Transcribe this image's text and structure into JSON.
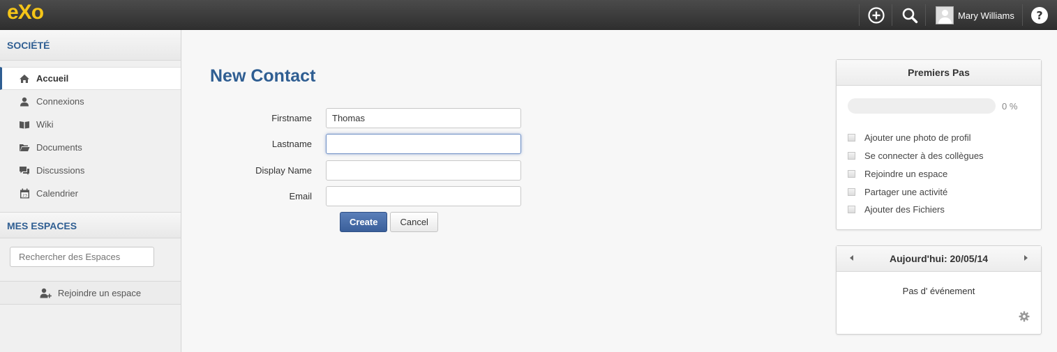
{
  "topbar": {
    "logo_text": "eXo",
    "user_name": "Mary Williams",
    "icons": [
      "add-icon",
      "search-icon",
      "help-icon"
    ]
  },
  "sidebar": {
    "company_title": "SOCIÉTÉ",
    "items": [
      {
        "label": "Accueil",
        "icon": "home-icon",
        "active": true
      },
      {
        "label": "Connexions",
        "icon": "user-icon",
        "active": false
      },
      {
        "label": "Wiki",
        "icon": "book-icon",
        "active": false
      },
      {
        "label": "Documents",
        "icon": "folder-icon",
        "active": false
      },
      {
        "label": "Discussions",
        "icon": "chat-icon",
        "active": false
      },
      {
        "label": "Calendrier",
        "icon": "calendar-icon",
        "active": false
      }
    ],
    "spaces_title": "MES ESPACES",
    "search_placeholder": "Rechercher des Espaces",
    "join_label": "Rejoindre un espace"
  },
  "main": {
    "title": "New Contact",
    "fields": [
      {
        "label": "Firstname",
        "value": "Thomas"
      },
      {
        "label": "Lastname",
        "value": ""
      },
      {
        "label": "Display Name",
        "value": ""
      },
      {
        "label": "Email",
        "value": ""
      }
    ],
    "create_label": "Create",
    "cancel_label": "Cancel"
  },
  "getting_started": {
    "title": "Premiers Pas",
    "progress": 0,
    "progress_text": "0 %",
    "tasks": [
      "Ajouter une photo de profil",
      "Se connecter à des collègues",
      "Rejoindre un espace",
      "Partager une activité",
      "Ajouter des Fichiers"
    ]
  },
  "calendar": {
    "title": "Aujourd'hui: 20/05/14",
    "no_event": "Pas d' événement"
  },
  "colors": {
    "accent": "#2f5e92",
    "logo": "#f5c518",
    "primary_button": "#3a5f9a"
  }
}
